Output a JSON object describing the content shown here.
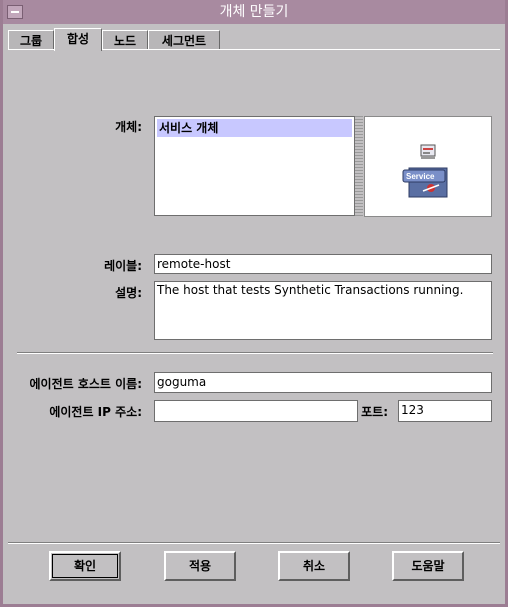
{
  "window": {
    "title": "개체 만들기"
  },
  "tabs": [
    {
      "label": "그룹"
    },
    {
      "label": "합성"
    },
    {
      "label": "노드"
    },
    {
      "label": "세그먼트"
    }
  ],
  "active_tab": "합성",
  "object": {
    "label": "개체:",
    "list_items": [
      "서비스 개체"
    ],
    "selected": "서비스 개체",
    "preview_icon": "service-icon",
    "preview_text": "Service"
  },
  "label_field": {
    "label": "레이블:",
    "value": "remote-host"
  },
  "description_field": {
    "label": "설명:",
    "value": "The host that tests Synthetic Transactions running."
  },
  "agent": {
    "host_label": "에이전트 호스트 이름:",
    "host_value": "goguma",
    "ip_label": "에이전트 IP 주소:",
    "ip_value": "",
    "port_label": "포트:",
    "port_value": "123"
  },
  "buttons": {
    "ok": "확인",
    "apply": "적용",
    "cancel": "취소",
    "help": "도움말"
  },
  "colors": {
    "titlebar": "#a88aa0",
    "selection": "#c8c8ff",
    "background": "#c2c0c2"
  }
}
